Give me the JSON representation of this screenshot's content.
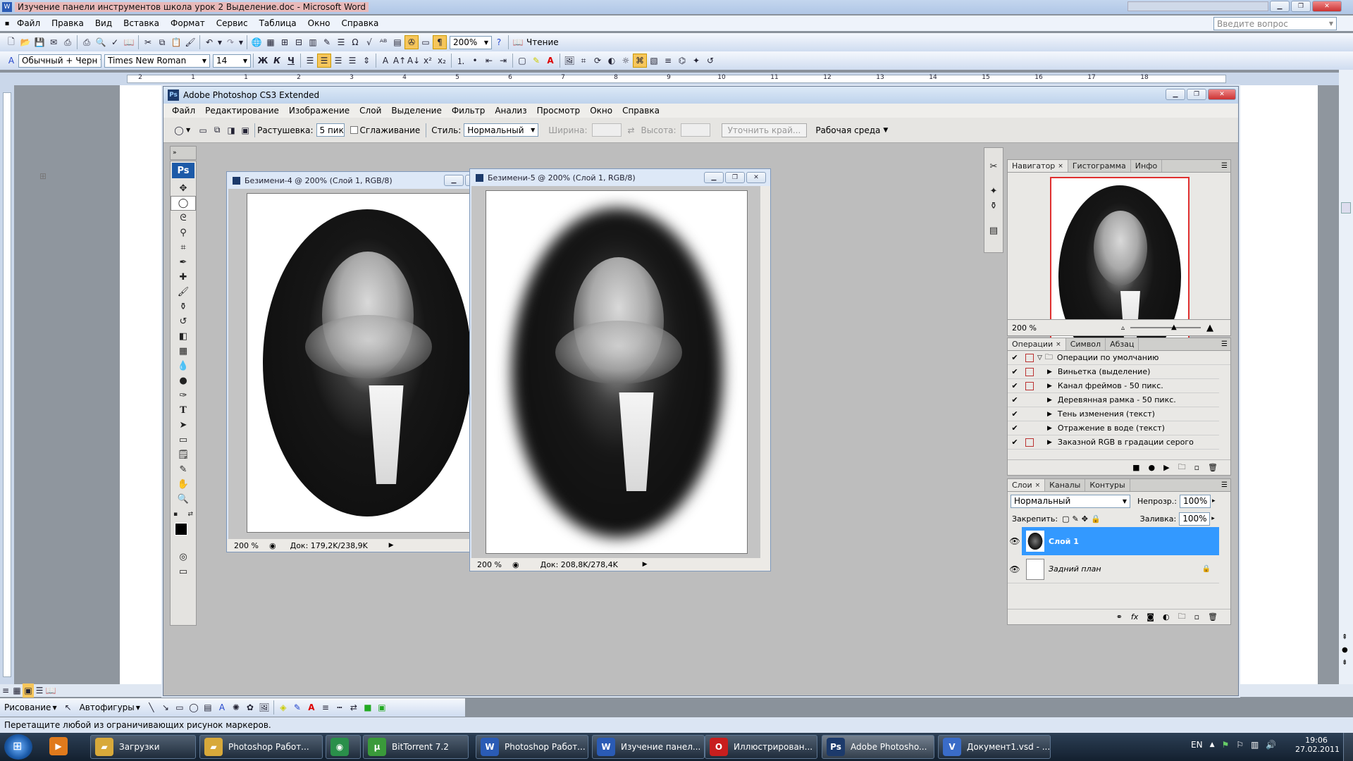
{
  "word": {
    "title": "Изучение панели инструментов школа урок 2 Выделение.doc - Microsoft Word",
    "menu": [
      "Файл",
      "Правка",
      "Вид",
      "Вставка",
      "Формат",
      "Сервис",
      "Таблица",
      "Окно",
      "Справка"
    ],
    "help_placeholder": "Введите вопрос",
    "zoom": "200%",
    "reading_label": "Чтение",
    "style": "Обычный + Черн",
    "font": "Times New Roman",
    "size": "14",
    "fmt": {
      "bold": "Ж",
      "italic": "К",
      "underline": "Ч"
    },
    "ruler_marks": [
      "2",
      "1",
      "1",
      "2",
      "3",
      "4",
      "5",
      "6",
      "7",
      "8",
      "9",
      "10",
      "11",
      "12",
      "13",
      "14",
      "15",
      "16",
      "17",
      "18"
    ],
    "draw_label": "Рисование",
    "autoshapes_label": "Автофигуры",
    "status": "Перетащите любой из ограничивающих рисунок маркеров."
  },
  "taskbar": {
    "tasks": [
      "Загрузки",
      "Photoshop Работ...",
      "",
      "BitTorrent 7.2",
      "Photoshop Работ...",
      "Изучение панел...",
      "Иллюстрирован...",
      "Adobe Photosho...",
      "Документ1.vsd - ..."
    ],
    "lang": "EN",
    "time": "19:06",
    "date": "27.02.2011"
  },
  "ps": {
    "title": "Adobe Photoshop CS3 Extended",
    "menu": [
      "Файл",
      "Редактирование",
      "Изображение",
      "Слой",
      "Выделение",
      "Фильтр",
      "Анализ",
      "Просмотр",
      "Окно",
      "Справка"
    ],
    "opts": {
      "feather_label": "Растушевка:",
      "feather_value": "5 пикс",
      "antialias_label": "Сглаживание",
      "style_label": "Стиль:",
      "style_value": "Нормальный",
      "width_label": "Ширина:",
      "height_label": "Высота:",
      "refine_label": "Уточнить край...",
      "workspace_label": "Рабочая среда"
    },
    "doc1": {
      "title": "Безимени-4 @ 200% (Слой 1, RGB/8)",
      "zoom": "200 %",
      "doc": "Док: 179,2K/238,9K"
    },
    "doc2": {
      "title": "Безимени-5 @ 200% (Слой 1, RGB/8)",
      "zoom": "200 %",
      "doc": "Док: 208,8K/278,4K"
    },
    "navigator": {
      "tabs": [
        "Навигатор",
        "Гистограмма",
        "Инфо"
      ],
      "zoom": "200 %"
    },
    "actions": {
      "tabs": [
        "Операции",
        "Символ",
        "Абзац"
      ],
      "set": "Операции по умолчанию",
      "items": [
        "Виньетка (выделение)",
        "Канал фреймов - 50 пикс.",
        "Деревянная рамка - 50 пикс.",
        "Тень изменения (текст)",
        "Отражение в воде (текст)",
        "Заказной RGB в градации серого"
      ]
    },
    "layers": {
      "tabs": [
        "Слои",
        "Каналы",
        "Контуры"
      ],
      "blend": "Нормальный",
      "opacity_label": "Непрозр.:",
      "opacity": "100%",
      "lock_label": "Закрепить:",
      "fill_label": "Заливка:",
      "fill": "100%",
      "items": [
        "Слой 1",
        "Задний план"
      ]
    },
    "colors": {
      "accent": "#3399ff",
      "nav_frame": "#e03030"
    }
  }
}
